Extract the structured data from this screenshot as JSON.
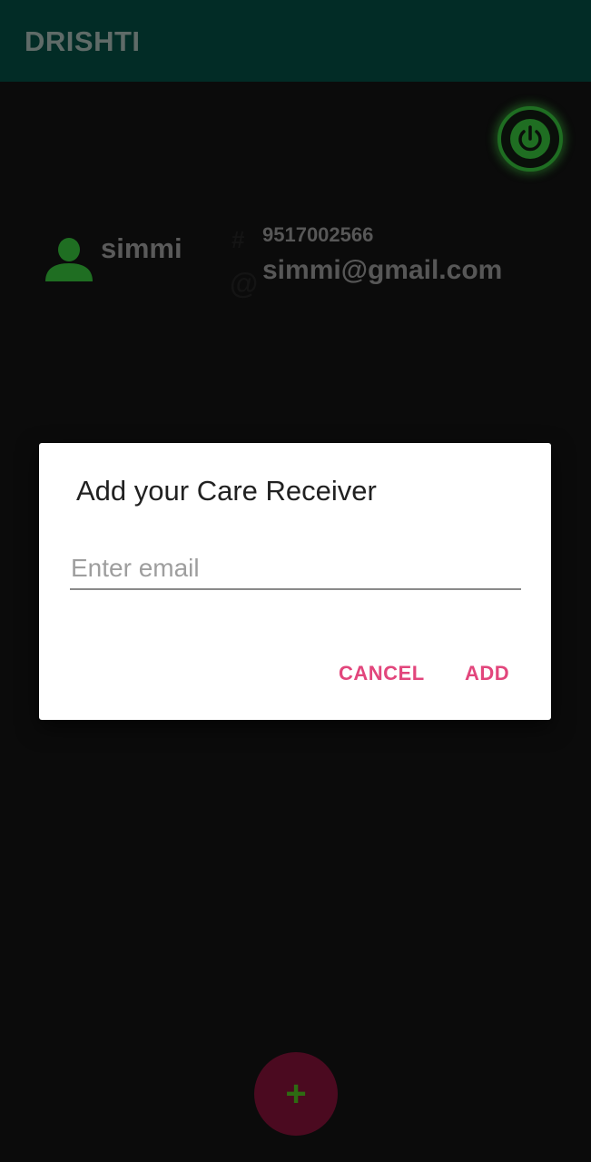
{
  "app_bar": {
    "title": "DRISHTI",
    "background": "#022c26"
  },
  "power_button": {
    "icon": "power-icon",
    "color": "#1f6e22"
  },
  "user_card": {
    "avatar_icon": "person-icon",
    "avatar_color": "#1f6e22",
    "name": "simmi",
    "phone_icon": "#",
    "phone": "9517002566",
    "email_icon": "@",
    "email": "simmi@gmail.com"
  },
  "dialog": {
    "title": "Add your Care Receiver",
    "email_placeholder": "Enter email",
    "email_value": "",
    "cancel_label": "CANCEL",
    "add_label": "ADD",
    "accent": "#e2467c"
  },
  "fab": {
    "icon": "plus-icon",
    "label": "+",
    "background": "#4b0a20"
  }
}
